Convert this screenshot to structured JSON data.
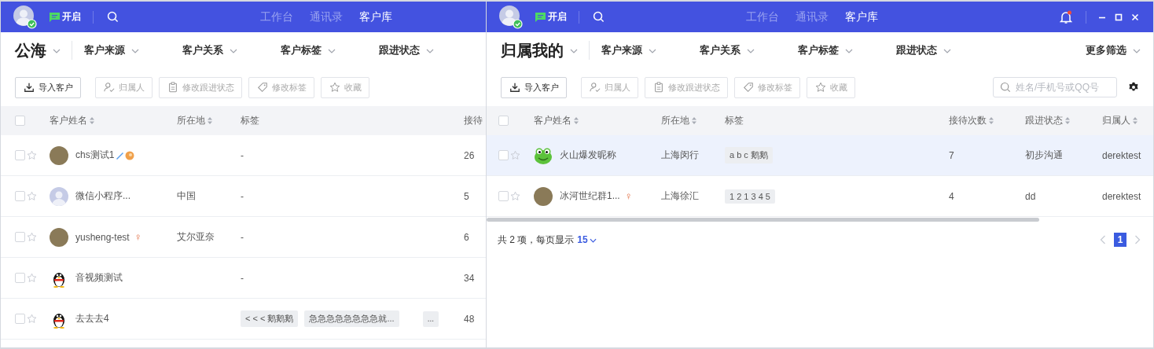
{
  "panels": [
    {
      "topbar": {
        "status_label": "开启",
        "nav": [
          {
            "label": "工作台",
            "selected": false
          },
          {
            "label": "通讯录",
            "selected": false
          },
          {
            "label": "客户库",
            "selected": true
          }
        ],
        "window_controls": false
      },
      "scope": "公海",
      "filters": [
        "客户来源",
        "客户关系",
        "客户标签",
        "跟进状态"
      ],
      "actions": [
        {
          "label": "导入客户",
          "kind": "import",
          "disabled": false
        },
        {
          "label": "归属人",
          "kind": "owner",
          "disabled": true
        },
        {
          "label": "修改跟进状态",
          "kind": "status",
          "disabled": true
        },
        {
          "label": "修改标签",
          "kind": "tag",
          "disabled": true
        },
        {
          "label": "收藏",
          "kind": "favorite",
          "disabled": true
        }
      ],
      "table": {
        "all_checked": false,
        "columns": [
          {
            "label": "客户姓名",
            "sortable": true
          },
          {
            "label": "所在地",
            "sortable": true
          },
          {
            "label": "标签",
            "sortable": false
          },
          {
            "label": "接待",
            "sortable": false
          }
        ],
        "rows": [
          {
            "checked": false,
            "starred": false,
            "highlighted": false,
            "avatar": {
              "kind": "photo"
            },
            "name": "chs测试1",
            "name_icons": [
              {
                "kind": "pen"
              },
              {
                "kind": "badge"
              }
            ],
            "tag_text": "-",
            "visits": "26"
          },
          {
            "checked": false,
            "starred": false,
            "highlighted": false,
            "avatar": {
              "kind": "default"
            },
            "name": "微信小程序...",
            "location": "中国",
            "tag_text": "-",
            "visits": "5"
          },
          {
            "checked": false,
            "starred": false,
            "highlighted": false,
            "avatar": {
              "kind": "photo"
            },
            "name": "yusheng-test",
            "gender": "♀",
            "location": "艾尔亚奈",
            "tag_text": "-",
            "visits": "6"
          },
          {
            "checked": false,
            "starred": false,
            "highlighted": false,
            "avatar": {
              "kind": "penguin"
            },
            "name": "音视频测试",
            "tag_text": "-",
            "visits": "34"
          },
          {
            "checked": false,
            "starred": false,
            "highlighted": false,
            "avatar": {
              "kind": "penguin"
            },
            "name": "去去去4",
            "tags": [
              "< < < 鹅鹅鹅",
              "急急急急急急急急就..."
            ],
            "tags_more": "...",
            "visits": "48"
          }
        ]
      }
    },
    {
      "topbar": {
        "status_label": "开启",
        "nav": [
          {
            "label": "工作台",
            "selected": false
          },
          {
            "label": "通讯录",
            "selected": false
          },
          {
            "label": "客户库",
            "selected": true
          }
        ],
        "window_controls": true,
        "notification": true
      },
      "scope": "归属我的",
      "filters": [
        "客户来源",
        "客户关系",
        "客户标签",
        "跟进状态"
      ],
      "more_filters": "更多筛选",
      "actions": [
        {
          "label": "导入客户",
          "kind": "import",
          "disabled": false
        },
        {
          "label": "归属人",
          "kind": "owner",
          "disabled": true
        },
        {
          "label": "修改跟进状态",
          "kind": "status",
          "disabled": true
        },
        {
          "label": "修改标签",
          "kind": "tag",
          "disabled": true
        },
        {
          "label": "收藏",
          "kind": "favorite",
          "disabled": true
        }
      ],
      "search": {
        "placeholder": "姓名/手机号或QQ号"
      },
      "table": {
        "all_checked": false,
        "columns": [
          {
            "label": "客户姓名",
            "sortable": true
          },
          {
            "label": "所在地",
            "sortable": true
          },
          {
            "label": "标签",
            "sortable": false
          },
          {
            "label": "接待次数",
            "sortable": true
          },
          {
            "label": "跟进状态",
            "sortable": true
          },
          {
            "label": "归属人",
            "sortable": true
          }
        ],
        "rows": [
          {
            "checked": false,
            "starred": false,
            "highlighted": true,
            "avatar": {
              "kind": "frog"
            },
            "name": "火山爆发昵称",
            "location": "上海闵行",
            "tags": [
              "a b c 鹅鹅"
            ],
            "visits": "7",
            "status": "初步沟通",
            "owner": "derektest"
          },
          {
            "checked": false,
            "starred": false,
            "highlighted": false,
            "avatar": {
              "kind": "photo"
            },
            "name": "冰河世纪群1...",
            "gender": "♀",
            "location": "上海徐汇",
            "tags": [
              "1 2 1 3 4 5"
            ],
            "visits": "4",
            "status": "dd",
            "owner": "derektest"
          }
        ]
      },
      "footer": {
        "summary": "共 2 项，每页显示",
        "page_size": "15",
        "pages": [
          {
            "label": "1",
            "selected": true
          }
        ]
      }
    }
  ]
}
